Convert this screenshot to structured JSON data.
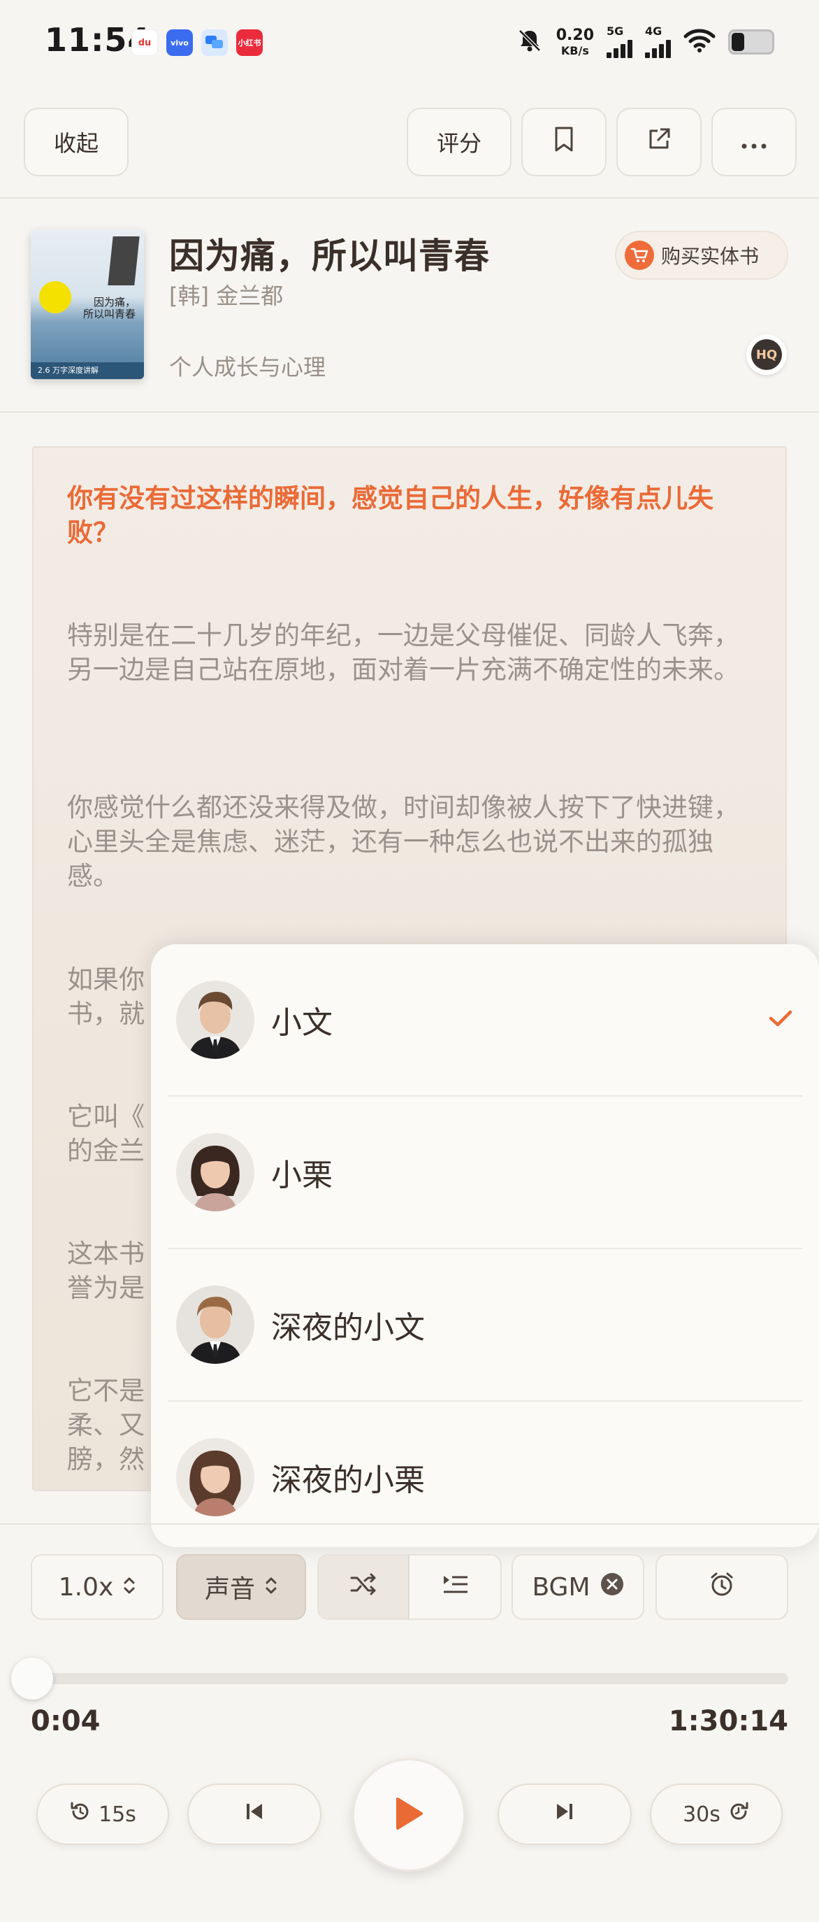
{
  "status_bar": {
    "time": "11:54",
    "apps": [
      "du",
      "vivo",
      "",
      "小红书"
    ],
    "net_speed": "0.20",
    "net_unit": "KB/s",
    "sig1": "5G",
    "sig2": "4G"
  },
  "toolbar": {
    "collapse": "收起",
    "rate": "评分"
  },
  "book": {
    "title": "因为痛，所以叫青春",
    "author": "[韩] 金兰都",
    "category": "个人成长与心理",
    "buy": "购买实体书",
    "hq": "HQ",
    "cover_title": "因为痛，\n所以叫青春",
    "cover_footer": "2.6 万字深度讲解"
  },
  "reader": {
    "paragraphs": [
      "你有没有过这样的瞬间，感觉自己的人生，好像有点儿失败？",
      " 特别是在二十几岁的年纪，一边是父母催促、同龄人飞奔，另一边是自己站在原地，面对着一片充满不确定性的未来。",
      "你感觉什么都还没来得及做，时间却像被人按下了快进键，心里头全是焦虑、迷茫，还有一种怎么也说不出来的孤独感。",
      "如果你",
      "书，就",
      "它叫《",
      "的金兰",
      "这本书",
      "誉为是",
      "它不是",
      "柔、又",
      "膀，然"
    ]
  },
  "voices": [
    {
      "name": "小文",
      "selected": true
    },
    {
      "name": "小栗",
      "selected": false
    },
    {
      "name": "深夜的小文",
      "selected": false
    },
    {
      "name": "深夜的小栗",
      "selected": false
    }
  ],
  "controls": {
    "speed": "1.0x",
    "voice": "声音",
    "bgm": "BGM"
  },
  "player": {
    "current": "0:04",
    "total": "1:30:14",
    "progress_fraction": 0.001,
    "rewind": "15s",
    "forward": "30s"
  },
  "colors": {
    "accent": "#ea6a36",
    "text": "#3b2f2a",
    "muted": "#9b918a"
  }
}
